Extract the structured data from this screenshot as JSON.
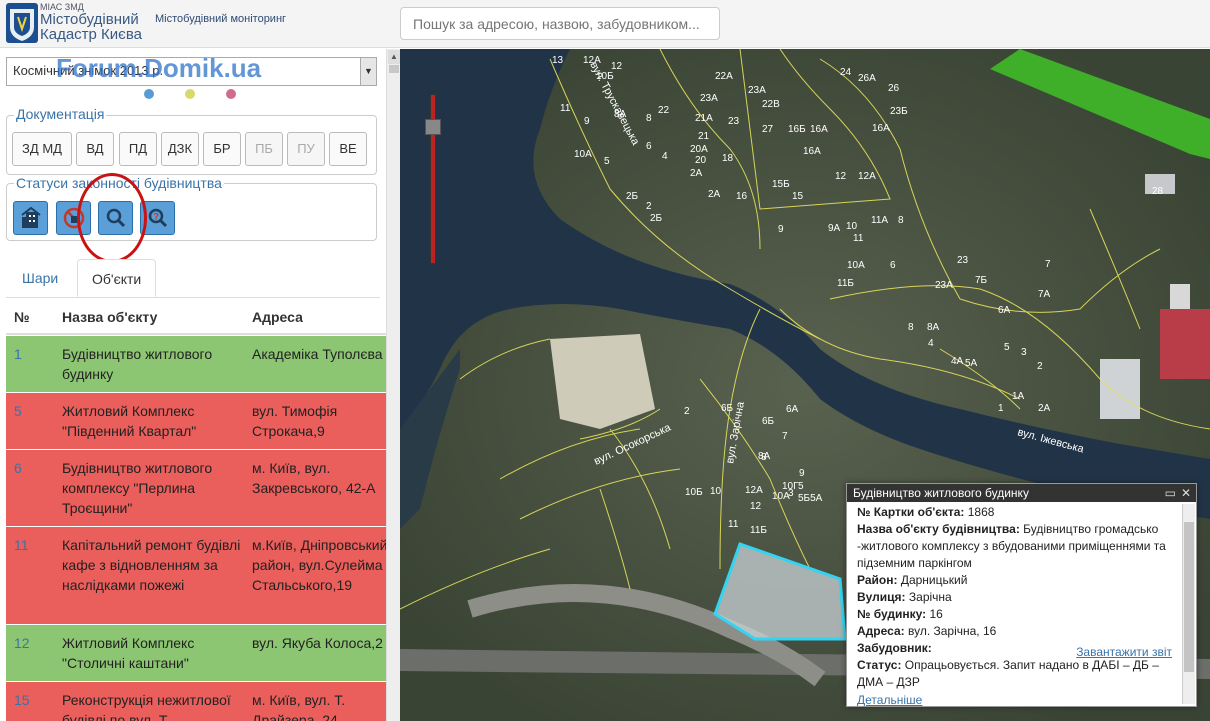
{
  "header": {
    "brand_small": "МІАС ЗМД",
    "brand_line1": "Містобудівний",
    "brand_line2": "Кадастр Києва",
    "subtitle": "Містобудівний моніторинг",
    "search_placeholder": "Пошук за адресою, назвою, забудовником..."
  },
  "sidebar": {
    "basemap_select": "Космічний знімок 2013 р.",
    "watermark": "Forum.Domik.ua",
    "dots": [
      "#5b9bd5",
      "#d9d96a",
      "#d16b90"
    ],
    "documentation_title": "Документація",
    "doc_buttons": [
      {
        "label": "ЗД МД",
        "enabled": true
      },
      {
        "label": "ВД",
        "enabled": true
      },
      {
        "label": "ПД",
        "enabled": true
      },
      {
        "label": "ДЗК",
        "enabled": true
      },
      {
        "label": "БР",
        "enabled": true
      },
      {
        "label": "ПБ",
        "enabled": false
      },
      {
        "label": "ПУ",
        "enabled": false
      },
      {
        "label": "ВЕ",
        "enabled": true
      }
    ],
    "status_title": "Статуси законності будівництва",
    "status_buttons": [
      "building-icon",
      "prohibited-icon",
      "search-icon",
      "question-icon"
    ],
    "tabs": [
      {
        "label": "Шари",
        "active": false
      },
      {
        "label": "Об'єкти",
        "active": true
      }
    ],
    "table": {
      "headers": [
        "№",
        "Назва об'єкту",
        "Адреса"
      ],
      "rows": [
        {
          "num": "1",
          "name": "Будівництво житлового будинку",
          "addr": "Академіка Туполєва",
          "status": "green"
        },
        {
          "num": "5",
          "name": "Житловий Комплекс \"Південний Квартал\"",
          "addr": "вул. Тимофія\nСтрокача,9",
          "status": "red"
        },
        {
          "num": "6",
          "name": "Будівництво житлового комплексу \"Перлина Троєщини\"",
          "addr": "м. Київ, вул.\nЗакревського, 42-А",
          "status": "red"
        },
        {
          "num": "11",
          "name": "Капітальний ремонт будівлі кафе з відновленням за наслідками пожежі",
          "addr": "м.Київ, Дніпровський\nрайон, вул.Сулейма\nСтальського,19",
          "status": "red"
        },
        {
          "num": "12",
          "name": "Житловий Комплекс \"Столичні каштани\"",
          "addr": "вул. Якуба Колоса,2",
          "status": "green"
        },
        {
          "num": "15",
          "name": "Реконструкція нежитлової будівлі по вул. Т.",
          "addr": "м. Київ, вул. Т.\nДрайзера, 24",
          "status": "red"
        }
      ]
    }
  },
  "map": {
    "streets": [
      "вул. Трускавецька",
      "вул. Осокорська",
      "вул. Зарічна",
      "вул. Іжевська"
    ],
    "house_numbers": [
      "13",
      "12А",
      "12",
      "10Б",
      "11",
      "9",
      "8А",
      "8",
      "6",
      "4",
      "10А",
      "5",
      "22",
      "23А",
      "21А",
      "21",
      "20А",
      "20",
      "2А",
      "18",
      "23",
      "22А",
      "23А",
      "22В",
      "27",
      "16Б",
      "16А",
      "16А",
      "12",
      "12А",
      "15Б",
      "15",
      "24",
      "26А",
      "26",
      "23Б",
      "16А",
      "28",
      "9",
      "9А",
      "10",
      "11",
      "11А",
      "8",
      "10А",
      "11Б",
      "6",
      "23А",
      "23",
      "7Б",
      "7",
      "7А",
      "6А",
      "8",
      "8А",
      "4",
      "4А",
      "5А",
      "5",
      "3",
      "2",
      "1А",
      "1",
      "2А",
      "2",
      "6Б",
      "6А",
      "6Б",
      "7",
      "8",
      "8А",
      "9",
      "5",
      "5Б5А",
      "10",
      "10Б",
      "12А",
      "12",
      "10А",
      "10Г",
      "11",
      "11Б",
      "3",
      "2Б",
      "2",
      "2Б",
      "2А",
      "16"
    ],
    "popup": {
      "title": "Будівництво житлового будинку",
      "card_label": "№ Картки об'єкта:",
      "card_value": "1868",
      "name_label": "Назва об'єкту будівництва:",
      "name_value": "Будівництво громадсько -житлового комплексу з вбудованими приміщеннями та підземним паркінгом",
      "district_label": "Район:",
      "district_value": "Дарницький",
      "street_label": "Вулиця:",
      "street_value": "Зарічна",
      "house_label": "№ будинку:",
      "house_value": "16",
      "address_label": "Адреса:",
      "address_value": "вул. Зарічна, 16",
      "developer_label": "Забудовник:",
      "developer_value": "",
      "status_label": "Статус:",
      "status_value": "Опрацьовується. Запит надано в ДАБІ – ДБ – ДМА – ДЗР",
      "link_label": "Завантажити звіт",
      "details_link": "Детальніше"
    }
  }
}
